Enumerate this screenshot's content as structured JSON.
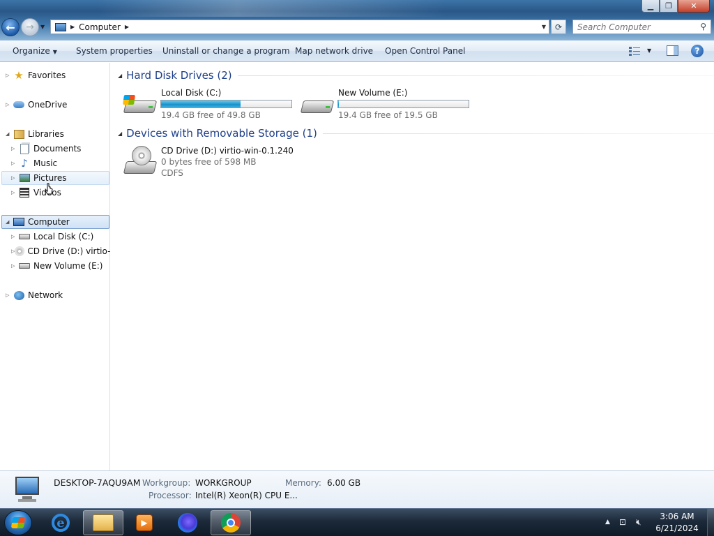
{
  "window": {
    "minimize_glyph": "▁",
    "maximize_glyph": "❐",
    "close_glyph": "✕"
  },
  "nav_buttons": {
    "back_glyph": "←",
    "forward_glyph": "→",
    "recent_glyph": "▼"
  },
  "address": {
    "crumb": "Computer",
    "icon": "computer-icon"
  },
  "search": {
    "placeholder": "Search Computer",
    "icon": "magnifier-icon"
  },
  "toolbar": {
    "organize": "Organize",
    "system_properties": "System properties",
    "uninstall": "Uninstall or change a program",
    "map_drive": "Map network drive",
    "control_panel": "Open Control Panel",
    "help_glyph": "?"
  },
  "nav": {
    "favorites": "Favorites",
    "onedrive": "OneDrive",
    "libraries": "Libraries",
    "documents": "Documents",
    "music": "Music",
    "pictures": "Pictures",
    "videos": "Videos",
    "computer": "Computer",
    "local_disk": "Local Disk (C:)",
    "cd_drive": "CD Drive (D:) virtio-w",
    "new_volume": "New Volume (E:)",
    "network": "Network"
  },
  "content": {
    "hard_disks_header": "Hard Disk Drives (2)",
    "removable_header": "Devices with Removable Storage (1)",
    "drives": [
      {
        "name": "Local Disk (C:)",
        "free": "19.4 GB free of 49.8 GB",
        "used_fraction": 0.61
      },
      {
        "name": "New Volume (E:)",
        "free": "19.4 GB free of 19.5 GB",
        "used_fraction": 0.005
      }
    ],
    "removable": [
      {
        "name": "CD Drive (D:) virtio-win-0.1.240",
        "free": "0 bytes free of 598 MB",
        "fs": "CDFS"
      }
    ]
  },
  "details": {
    "computer_name": "DESKTOP-7AQU9AM",
    "workgroup_label": "Workgroup:",
    "workgroup": "WORKGROUP",
    "memory_label": "Memory:",
    "memory": "6.00 GB",
    "processor_label": "Processor:",
    "processor": "Intel(R) Xeon(R) CPU E..."
  },
  "taskbar": {
    "apps": [
      "internet-explorer",
      "file-explorer",
      "media-center",
      "firefox",
      "chrome"
    ],
    "active_app": "file-explorer",
    "time": "3:06 AM",
    "date": "6/21/2024",
    "tray_expand_glyph": "▲"
  }
}
